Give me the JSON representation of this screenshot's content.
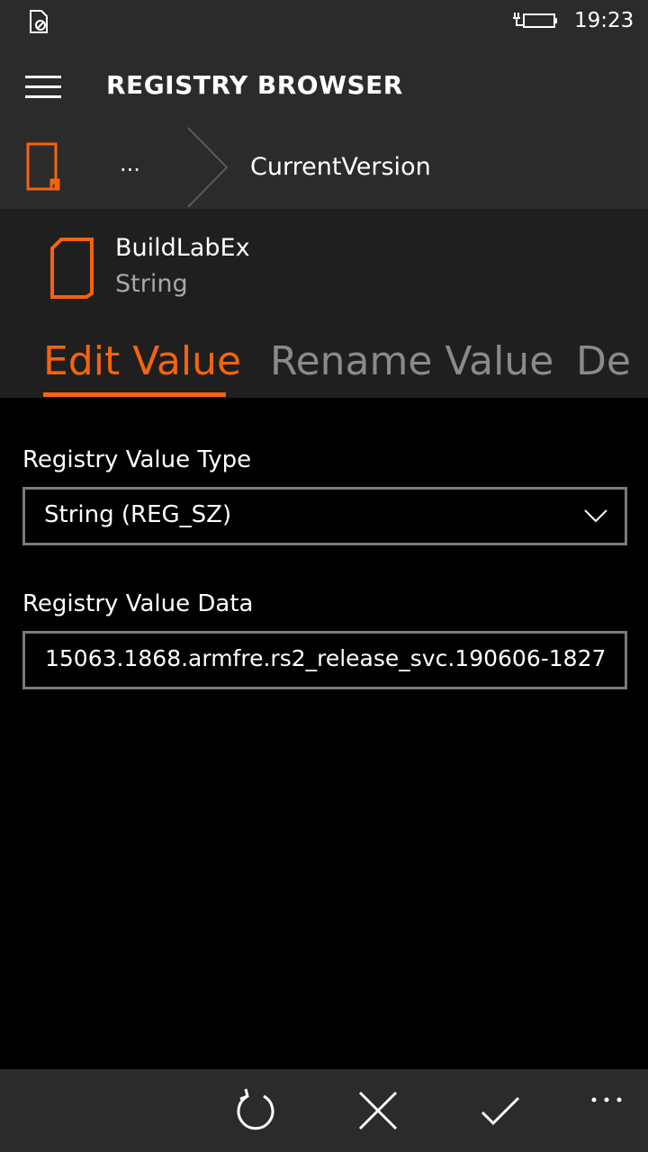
{
  "status_bar": {
    "time": "19:23",
    "icons": [
      "no-sim-icon",
      "battery-charging-icon"
    ]
  },
  "title_bar": {
    "title": "REGISTRY BROWSER",
    "menu_icon": "hamburger-icon"
  },
  "breadcrumb": {
    "root_icon": "registry-root-icon",
    "ellipsis": "...",
    "current": "CurrentVersion"
  },
  "value": {
    "name": "BuildLabEx",
    "type": "String",
    "icon": "value-file-icon"
  },
  "tabs": [
    {
      "label": "Edit Value",
      "active": true
    },
    {
      "label": "Rename Value",
      "active": false
    },
    {
      "label": "De",
      "active": false
    }
  ],
  "form": {
    "type_label": "Registry Value Type",
    "type_selected": "String (REG_SZ)",
    "data_label": "Registry Value Data",
    "data_value": "15063.1868.armfre.rs2_release_svc.190606-1827"
  },
  "app_bar": {
    "buttons": [
      "refresh-icon",
      "cancel-icon",
      "accept-icon",
      "more-icon"
    ]
  },
  "colors": {
    "accent": "#f7630c",
    "chrome": "#2b2b2b",
    "header": "#1f1f1f",
    "background": "#000000"
  }
}
